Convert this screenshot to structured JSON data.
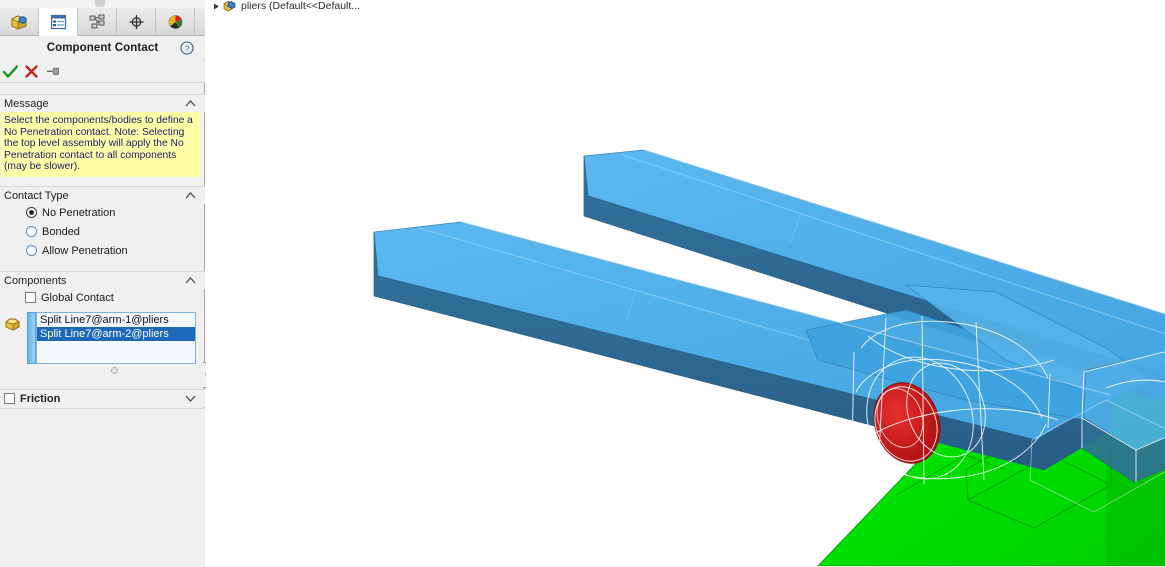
{
  "panel": {
    "title": "Component Contact",
    "tabs": [
      {
        "name": "feature-manager-design-tree",
        "icon": "yellow-cube-icon",
        "active": false
      },
      {
        "name": "property-manager",
        "icon": "property-list-icon",
        "active": true
      },
      {
        "name": "configuration-manager",
        "icon": "configuration-icon",
        "active": false
      },
      {
        "name": "dimxpert-manager",
        "icon": "crosshair-icon",
        "active": false
      },
      {
        "name": "display-manager",
        "icon": "color-wheel-icon",
        "active": false
      }
    ],
    "actions": {
      "ok_label": "OK",
      "cancel_label": "Cancel",
      "pin_label": "Keep Visible"
    },
    "help_label": "Help",
    "message": {
      "header": "Message",
      "collapsed": false,
      "text": "Select the components/bodies to define a No Penetration contact. Note: Selecting the top level assembly will apply the No Penetration contact to all components (may be slower)."
    },
    "contact_type": {
      "header": "Contact Type",
      "collapsed": false,
      "options": [
        {
          "label": "No Penetration",
          "selected": true
        },
        {
          "label": "Bonded",
          "selected": false
        },
        {
          "label": "Allow Penetration",
          "selected": false
        }
      ]
    },
    "components": {
      "header": "Components",
      "collapsed": false,
      "global_contact": {
        "label": "Global Contact",
        "checked": false
      },
      "selection_icon": "component-box-icon",
      "items": [
        {
          "label": "Split Line7@arm-1@pliers",
          "highlighted": false
        },
        {
          "label": "Split Line7@arm-2@pliers",
          "highlighted": true
        }
      ]
    },
    "friction": {
      "header": "Friction",
      "checked": false,
      "collapsed": true
    }
  },
  "graphics": {
    "tree_item": {
      "label": "pliers  (Default<<Default...",
      "expander": "collapsed-triangle-icon",
      "icon": "assembly-icon"
    },
    "colors": {
      "arm_top": "#4dafe8",
      "arm_side": "#2e6f9e",
      "arm_dark": "#2a5f87",
      "pin_red": "#cc1111",
      "selected_green": "#00e800",
      "wireframe": "#ffffff",
      "background": "#ffffff"
    }
  }
}
